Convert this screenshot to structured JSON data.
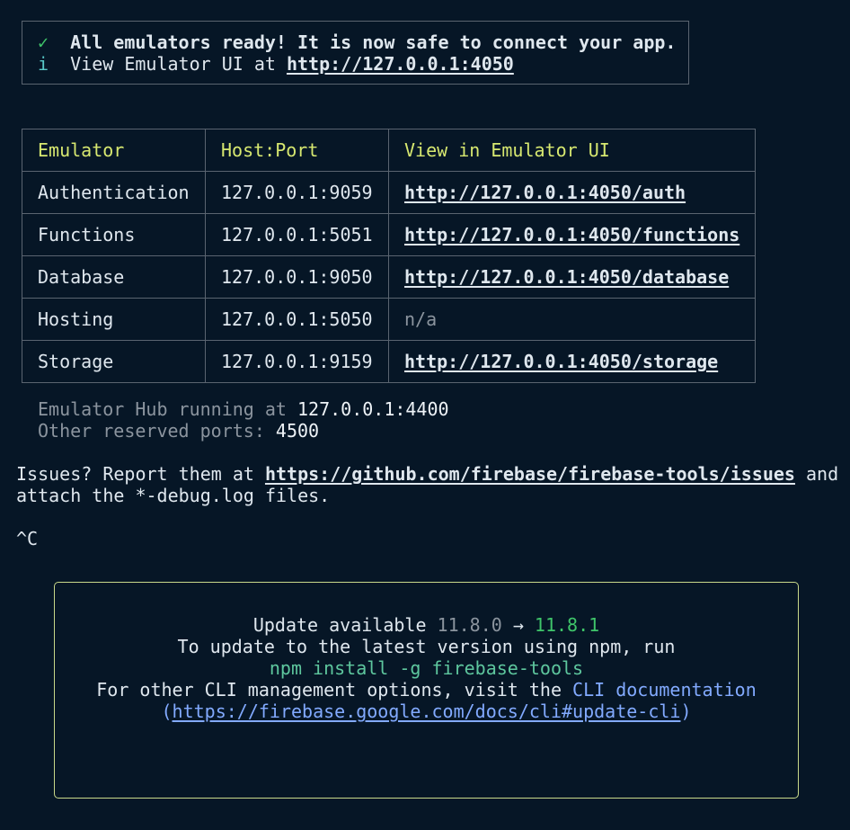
{
  "ready": {
    "check_glyph": "✓",
    "message": "All emulators ready! It is now safe to connect your app.",
    "info_glyph": "i",
    "ui_prefix": "View Emulator UI at ",
    "ui_url": "http://127.0.0.1:4050"
  },
  "table": {
    "headers": [
      "Emulator",
      "Host:Port",
      "View in Emulator UI"
    ],
    "rows": [
      {
        "name": "Authentication",
        "host": "127.0.0.1:9059",
        "url": "http://127.0.0.1:4050/auth"
      },
      {
        "name": "Functions",
        "host": "127.0.0.1:5051",
        "url": "http://127.0.0.1:4050/functions"
      },
      {
        "name": "Database",
        "host": "127.0.0.1:9050",
        "url": "http://127.0.0.1:4050/database"
      },
      {
        "name": "Hosting",
        "host": "127.0.0.1:5050",
        "url": "n/a"
      },
      {
        "name": "Storage",
        "host": "127.0.0.1:9159",
        "url": "http://127.0.0.1:4050/storage"
      }
    ]
  },
  "hub": {
    "label": "Emulator Hub running at ",
    "value": "127.0.0.1:4400"
  },
  "reserved": {
    "label": "Other reserved ports: ",
    "value": "4500"
  },
  "issues": {
    "prefix": "Issues? Report them at ",
    "url": "https://github.com/firebase/firebase-tools/issues",
    "suffix": " and",
    "line2": "attach the *-debug.log files."
  },
  "interrupt": "^C",
  "update": {
    "label": "Update available ",
    "old_version": "11.8.0",
    "arrow": " → ",
    "new_version": "11.8.1",
    "line2": "To update to the latest version using npm, run",
    "command": "npm install -g firebase-tools",
    "line4_prefix": "For other CLI management options, visit the ",
    "doc_label": "CLI documentation",
    "paren_open": "(",
    "doc_url": "https://firebase.google.com/docs/cli#update-cli",
    "paren_close": ")"
  },
  "colors": {
    "background": "#061626",
    "header": "#d7e870",
    "success": "#3fc56a",
    "command": "#5ec79e",
    "link_blue": "#82aaff",
    "box_border": "#c9d98a"
  }
}
